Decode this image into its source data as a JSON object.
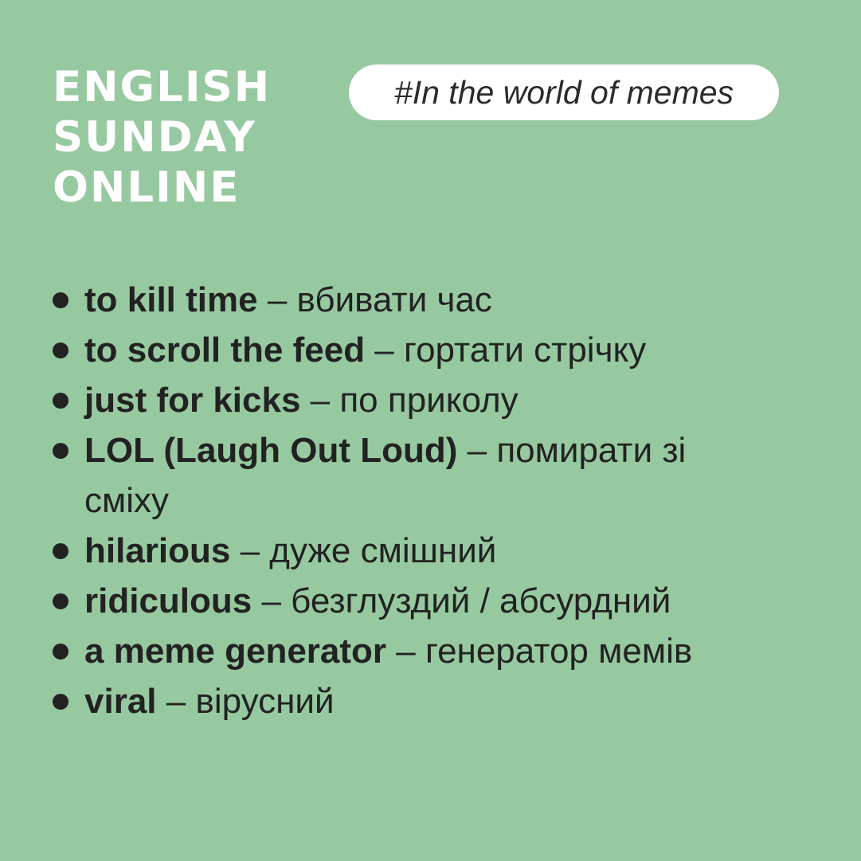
{
  "brand": {
    "line1": "ENGLISH",
    "line2": "SUNDAY",
    "line3": "ONLINE"
  },
  "tag": "#In the world of memes",
  "dash": " – ",
  "vocab": [
    {
      "term": "to kill time",
      "translation": "вбивати час"
    },
    {
      "term": "to scroll the feed",
      "translation": "гортати стрічку"
    },
    {
      "term": "just for kicks",
      "translation": "по приколу"
    },
    {
      "term": "LOL (Laugh Out Loud)",
      "translation": "помирати зі сміху"
    },
    {
      "term": "hilarious",
      "translation": "дуже смішний"
    },
    {
      "term": "ridiculous",
      "translation": "безглуздий / абсурдний"
    },
    {
      "term": "a meme generator",
      "translation": "генератор мемів"
    },
    {
      "term": "viral",
      "translation": "вірусний"
    }
  ]
}
